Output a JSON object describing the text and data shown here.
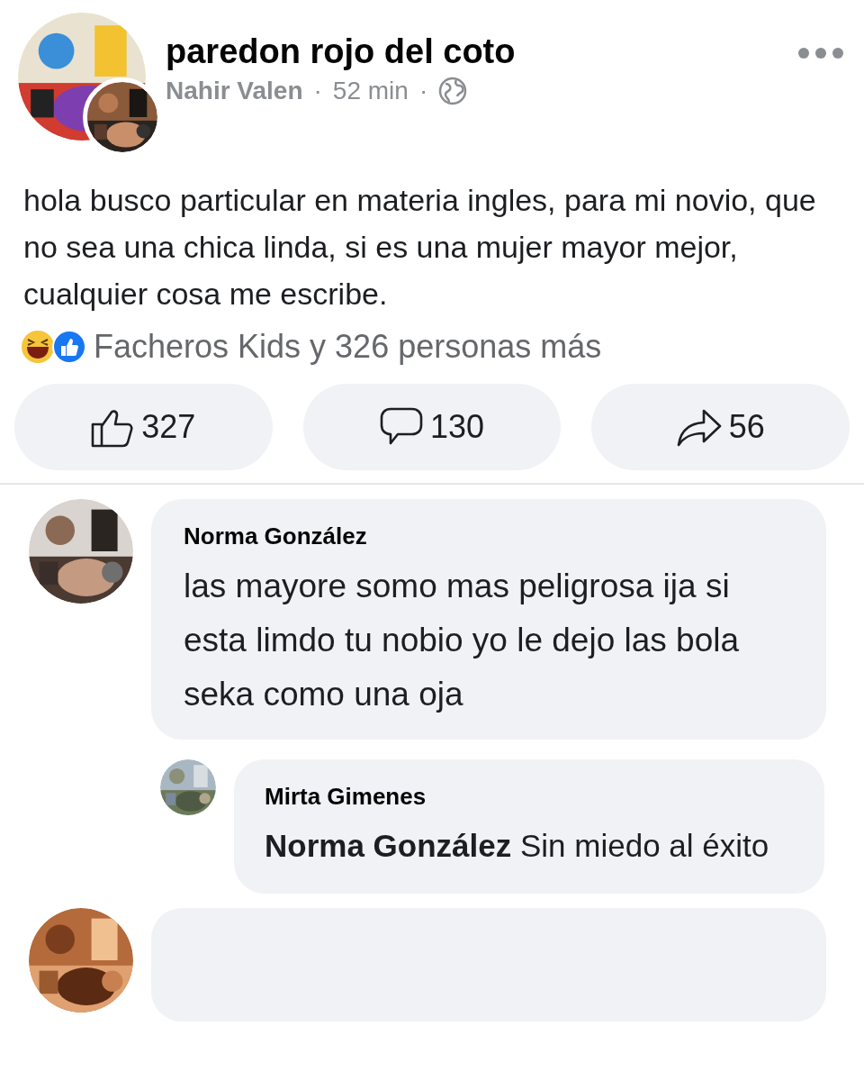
{
  "post": {
    "group": "paredon rojo del coto",
    "author": "Nahir Valen",
    "separator": "·",
    "time": "52 min",
    "text": "hola busco particular en materia ingles, para mi novio, que no sea una chica linda, si es una mujer mayor mejor, cualquier cosa me escribe.",
    "reactions_summary": "Facheros Kids y 326 personas más"
  },
  "actions": [
    {
      "kind": "like",
      "count": "327"
    },
    {
      "kind": "comment",
      "count": "130"
    },
    {
      "kind": "share",
      "count": "56"
    }
  ],
  "comments": [
    {
      "kind": "comment",
      "author": "Norma González",
      "text": "las mayore somo mas peligrosa ija si esta limdo tu nobio yo le dejo las bola seka como una oja"
    },
    {
      "kind": "reply",
      "author": "Mirta Gimenes",
      "text": "**Norma González** Sin miedo al éxito"
    },
    {
      "kind": "comment"
    }
  ]
}
